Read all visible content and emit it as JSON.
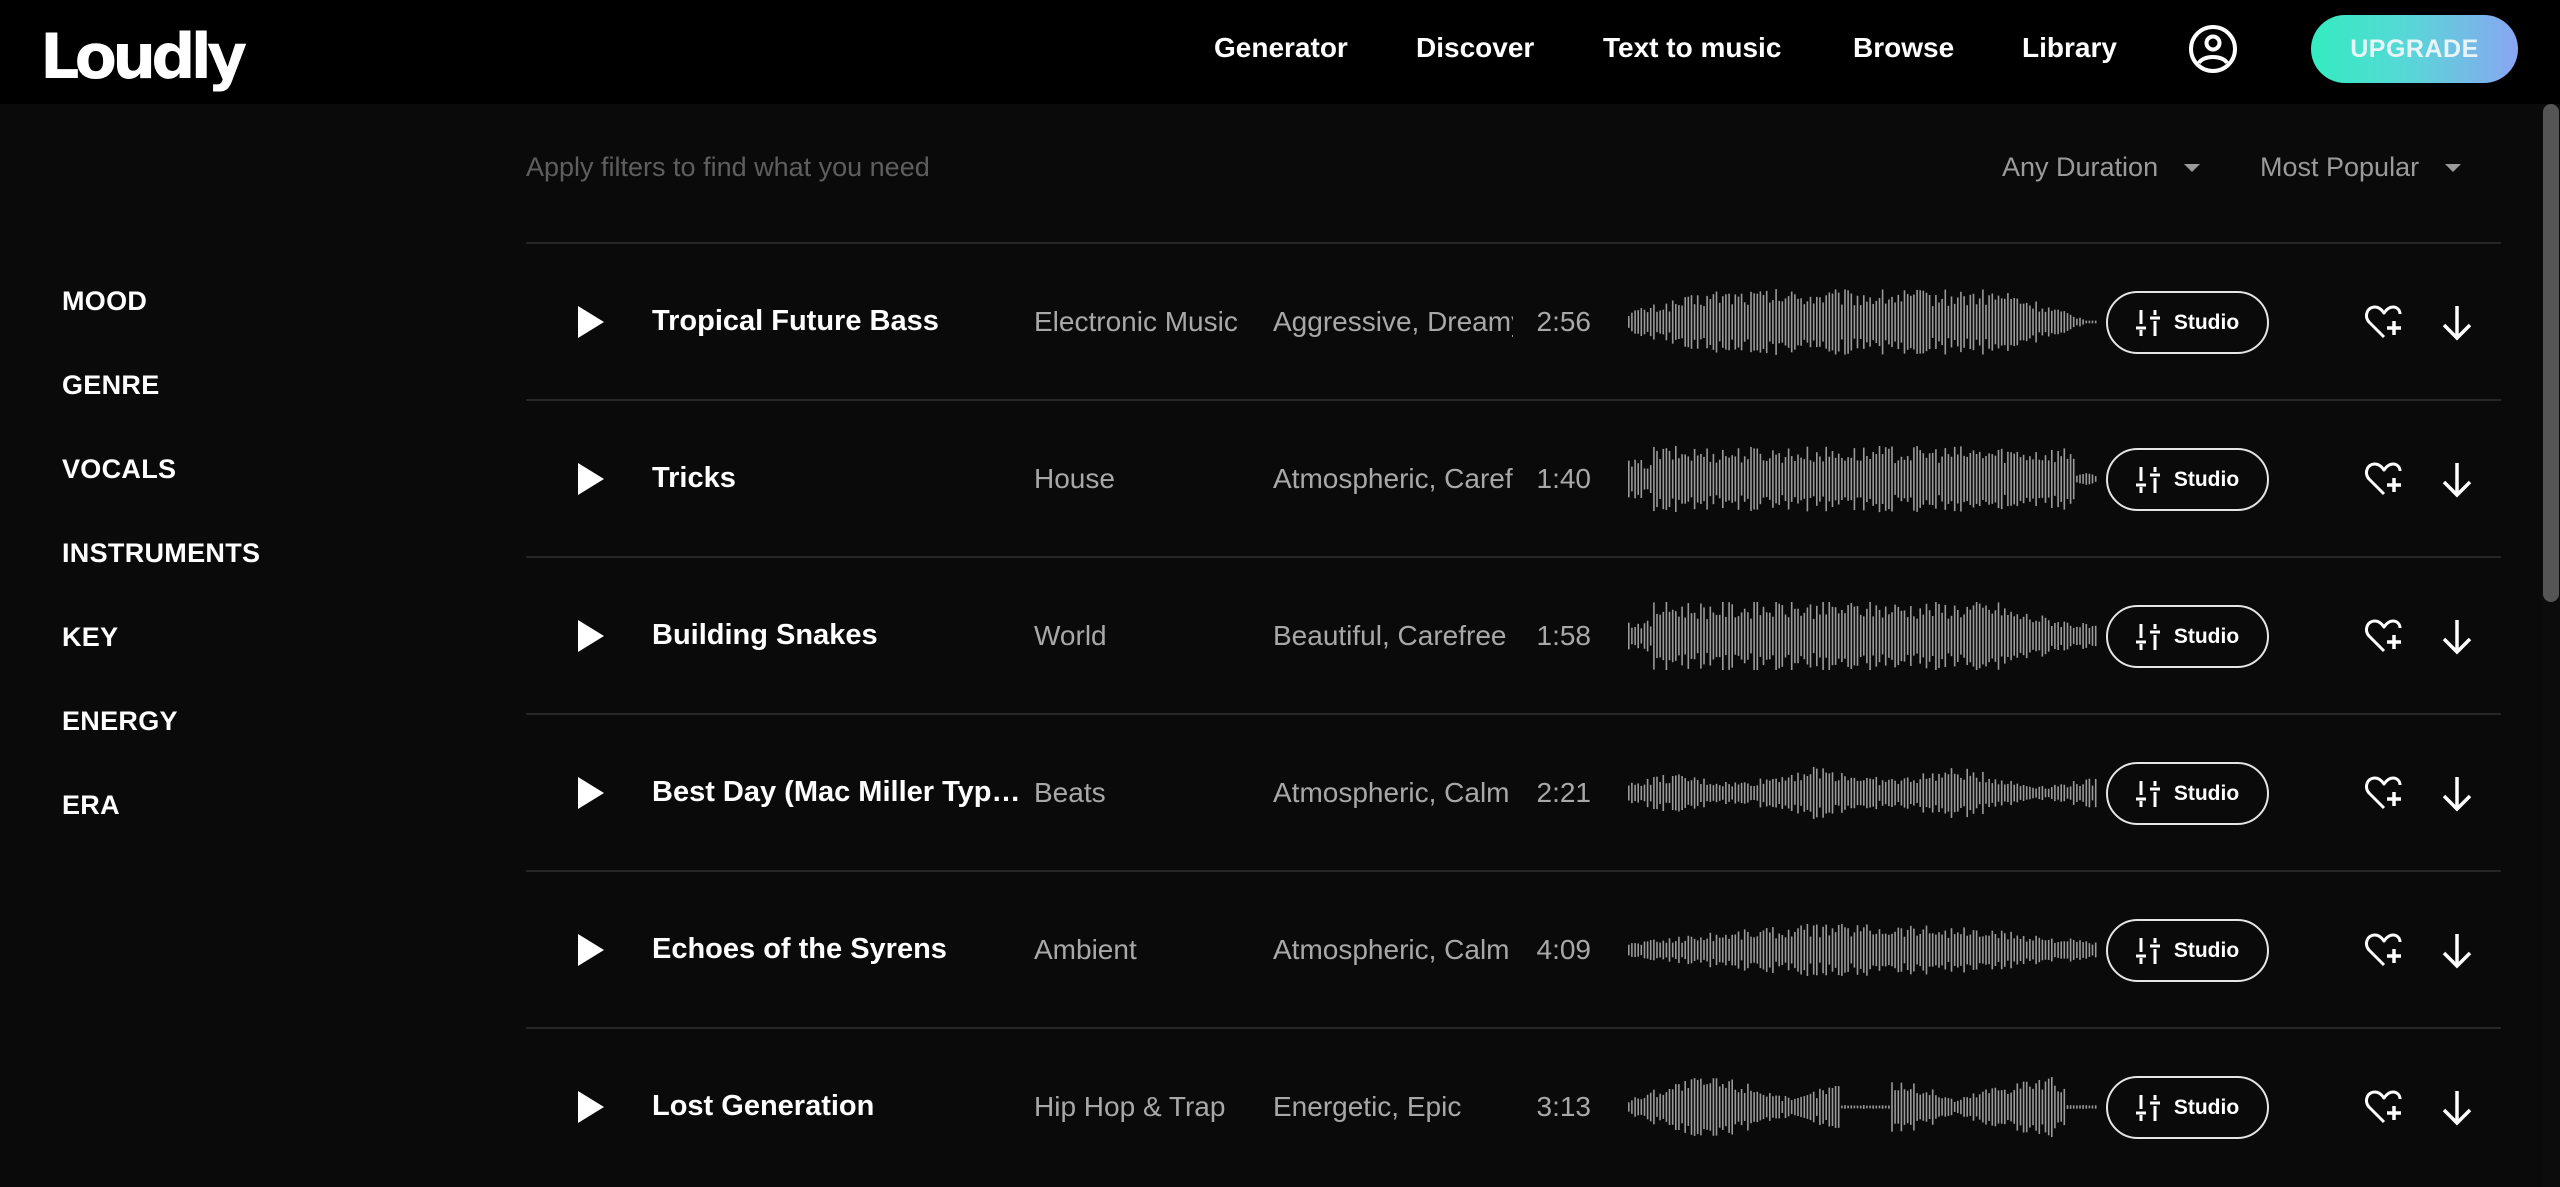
{
  "header": {
    "logo": "Loudly",
    "nav": [
      {
        "label": "Generator"
      },
      {
        "label": "Discover"
      },
      {
        "label": "Text to music"
      },
      {
        "label": "Browse"
      },
      {
        "label": "Library"
      }
    ],
    "profile_icon": "user-circle-icon",
    "upgrade_label": "UPGRADE"
  },
  "sidebar": {
    "items": [
      {
        "label": "MOOD"
      },
      {
        "label": "GENRE"
      },
      {
        "label": "VOCALS"
      },
      {
        "label": "INSTRUMENTS"
      },
      {
        "label": "KEY"
      },
      {
        "label": "ENERGY"
      },
      {
        "label": "ERA"
      }
    ]
  },
  "filters": {
    "hint": "Apply filters to find what you need",
    "duration": {
      "selected": "Any Duration"
    },
    "sort": {
      "selected": "Most Popular"
    }
  },
  "tracks": [
    {
      "title": "Tropical Future Bass",
      "genre": "Electronic Music",
      "moods": "Aggressive, Dreamy",
      "duration": "2:56",
      "studio_label": "Studio",
      "waveform_profile": "fade-out"
    },
    {
      "title": "Tricks",
      "genre": "House",
      "moods": "Atmospheric, Carefree",
      "duration": "1:40",
      "studio_label": "Studio",
      "waveform_profile": "dense"
    },
    {
      "title": "Building Snakes",
      "genre": "World",
      "moods": "Beautiful, Carefree",
      "duration": "1:58",
      "studio_label": "Studio",
      "waveform_profile": "dense-taper"
    },
    {
      "title": "Best Day (Mac Miller Type Beat)",
      "genre": "Beats",
      "moods": "Atmospheric, Calm",
      "duration": "2:21",
      "studio_label": "Studio",
      "waveform_profile": "moderate"
    },
    {
      "title": "Echoes of the Syrens",
      "genre": "Ambient",
      "moods": "Atmospheric, Calm",
      "duration": "4:09",
      "studio_label": "Studio",
      "waveform_profile": "swell"
    },
    {
      "title": "Lost Generation",
      "genre": "Hip Hop & Trap",
      "moods": "Energetic, Epic",
      "duration": "3:13",
      "studio_label": "Studio",
      "waveform_profile": "sparse-two-part"
    }
  ],
  "colors": {
    "background": "#0a0a0a",
    "topbar": "#000000",
    "upgrade_gradient_start": "#33ecc0",
    "upgrade_gradient_end": "#8aa5f2",
    "secondary_text": "#a8a8a8",
    "hint_text": "#5e5e5e",
    "waveform": "#9a9a9a",
    "divider": "#262626"
  },
  "scroll": {
    "position_fraction": 0.0,
    "visible_fraction": 0.46
  }
}
